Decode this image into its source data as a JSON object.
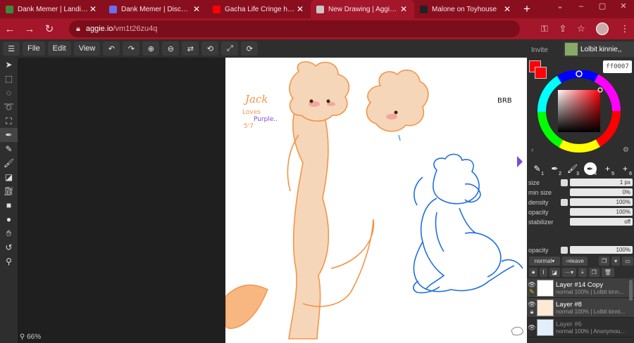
{
  "browser": {
    "tabs": [
      {
        "title": "Dank Memer | Landing",
        "color": "#3d8a3a",
        "active": false
      },
      {
        "title": "Dank Memer | Discord Bots",
        "color": "#6b6ef0",
        "active": false
      },
      {
        "title": "Gacha Life Cringe has gone way",
        "color": "#ff0000",
        "active": false
      },
      {
        "title": "New Drawing | Aggie.io",
        "color": "#c8c8c8",
        "active": true
      },
      {
        "title": "Malone on Toyhouse",
        "color": "#222222",
        "active": false
      }
    ],
    "url_host": "aggie.io",
    "url_path": "/vm1t26zu4q"
  },
  "menu": {
    "file": "File",
    "edit": "Edit",
    "view": "View"
  },
  "status": {
    "zoom": "66%"
  },
  "panel": {
    "invite": "Invite",
    "username": "Lolbit kinnie,,",
    "hex": "ff0007",
    "primary_color": "#ff0007",
    "brush_slots": [
      "1",
      "2",
      "3",
      "4",
      "5",
      "6"
    ],
    "props": [
      {
        "label": "size",
        "value": "1 px",
        "check": true
      },
      {
        "label": "min size",
        "value": "0%",
        "check": false
      },
      {
        "label": "density",
        "value": "100%",
        "check": true
      },
      {
        "label": "opacity",
        "value": "100%",
        "check": false
      },
      {
        "label": "stabilizer",
        "value": "off",
        "check": false
      }
    ],
    "layer_opacity_label": "opacity",
    "layer_opacity": "100%",
    "blend_mode": "normal",
    "leave": "leave",
    "layers": [
      {
        "name": "Layer #14 Copy",
        "meta": "normal 100% | Lolbit kinn...",
        "selected": true,
        "dim": false
      },
      {
        "name": "Layer #8",
        "meta": "normal 100% | Lolbit kinni...",
        "selected": true,
        "dim": false
      },
      {
        "name": "Layer #6",
        "meta": "normal 100% | Anonymou...",
        "selected": false,
        "dim": true
      }
    ]
  },
  "drawing": {
    "name_text": "Jack",
    "loves_text": "Loves",
    "purple_text": "Purple..",
    "height_text": "5'7",
    "brb_text": "BRB"
  }
}
